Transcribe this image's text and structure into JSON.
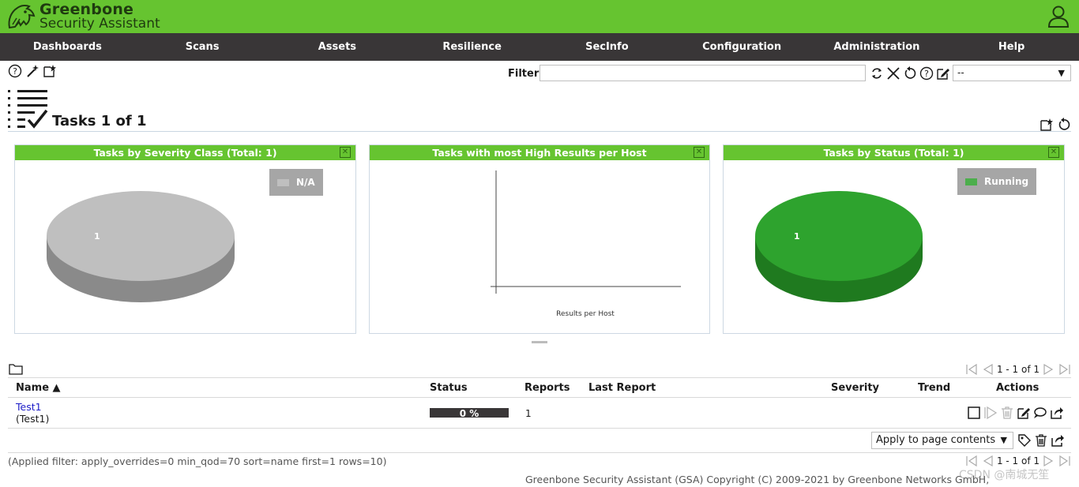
{
  "app": {
    "brand_line1": "Greenbone",
    "brand_line2": "Security Assistant"
  },
  "nav": {
    "items": [
      "Dashboards",
      "Scans",
      "Assets",
      "Resilience",
      "SecInfo",
      "Configuration",
      "Administration",
      "Help"
    ]
  },
  "filter": {
    "label": "Filter",
    "value": "",
    "select_value": "--"
  },
  "page": {
    "title": "Tasks 1 of 1"
  },
  "panels": [
    {
      "title": "Tasks by Severity Class (Total: 1)",
      "legend_label": "N/A",
      "legend_color": "#bfbfbf",
      "slice_label": "1",
      "pie_top_color": "#bfbfbf",
      "pie_side_color": "#8a8a8a"
    },
    {
      "title": "Tasks with most High Results per Host",
      "axis_label": "Results per Host"
    },
    {
      "title": "Tasks by Status (Total: 1)",
      "legend_label": "Running",
      "legend_color": "#4cae4c",
      "slice_label": "1",
      "pie_top_color": "#2ea32e",
      "pie_side_color": "#1f7a1f"
    }
  ],
  "table": {
    "pager_text": "1 - 1 of 1",
    "headers": {
      "name": "Name ▲",
      "status": "Status",
      "reports": "Reports",
      "last_report": "Last Report",
      "severity": "Severity",
      "trend": "Trend",
      "actions": "Actions"
    },
    "rows": [
      {
        "name": "Test1",
        "comment": "(Test1)",
        "status_text": "0 %",
        "reports": "1",
        "last_report": "",
        "severity": "",
        "trend": ""
      }
    ],
    "bulk_action": "Apply to page contents"
  },
  "footer": {
    "applied_filter": "(Applied filter: apply_overrides=0 min_qod=70 sort=name first=1 rows=10)",
    "copyright": "Greenbone Security Assistant (GSA) Copyright (C) 2009-2021 by Greenbone Networks GmbH, www.greenbone.net",
    "watermark": "CSDN @南城无笙"
  },
  "colors": {
    "brand_green": "#66c430",
    "nav_bg": "#393637",
    "link_blue": "#1c1cc8"
  }
}
